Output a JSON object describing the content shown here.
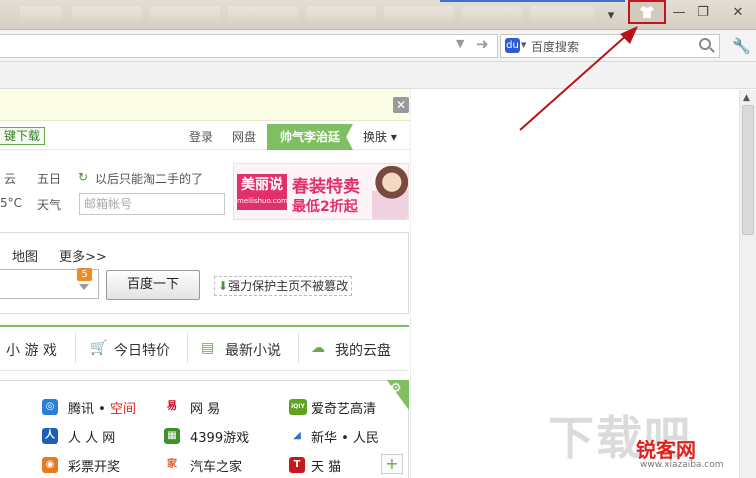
{
  "window": {
    "title_tabs": [
      "",
      "",
      "",
      "",
      "",
      "",
      "",
      ""
    ],
    "controls": {
      "skin": "",
      "minimize": "—",
      "maximize": "❐",
      "close": "✕"
    },
    "tab_dropdown": "▾"
  },
  "toolbar": {
    "address_value": "",
    "search_engine_label": "百度搜索",
    "settings_icon": "🔧"
  },
  "notice": {
    "close_symbol": "✕"
  },
  "header": {
    "quick_download": "键下载",
    "login": "登录",
    "netdisk": "网盘",
    "skin_badge": "帅气李治廷",
    "skin_menu": "换肤 ▾"
  },
  "weather": {
    "line1_a": "云",
    "line1_b": "五日",
    "tip": "以后只能淘二手的了",
    "line2_a": "5°C",
    "line2_b": "天气",
    "mailbox_placeholder": "邮箱帐号"
  },
  "ad": {
    "logo": "美丽说",
    "logo_url": "meilishuo.com",
    "headline": "春装特卖",
    "subline": "最低2折起"
  },
  "search": {
    "tabs": [
      "地图",
      "更多>>"
    ],
    "input_value": "",
    "badge": "5",
    "button": "百度一下",
    "protect_text": "强力保护主页不被篡改"
  },
  "features": {
    "items": [
      {
        "icon": "",
        "label": "小 游 戏"
      },
      {
        "icon": "🛒",
        "label": "今日特价"
      },
      {
        "icon": "▤",
        "label": "最新小说"
      },
      {
        "icon": "☁",
        "label": "我的云盘"
      }
    ]
  },
  "sites": {
    "col1": [
      {
        "label": "腾讯",
        "extra": "空间",
        "icon": "◎"
      },
      {
        "label": "人 人 网",
        "extra": "",
        "icon": "人"
      },
      {
        "label": "彩票开奖",
        "extra": "",
        "icon": "◉"
      }
    ],
    "col2": [
      {
        "label": "网  易",
        "icon": "易"
      },
      {
        "label": "4399游戏",
        "icon": "▦"
      },
      {
        "label": "汽车之家",
        "icon": "家"
      }
    ],
    "col3": [
      {
        "label": "爱奇艺高清",
        "icon": "iQIY"
      },
      {
        "label": "新华 • 人民",
        "icon": "◢"
      },
      {
        "label": "天  猫",
        "icon": "T"
      }
    ],
    "add_symbol": "+",
    "settings_symbol": "⚙"
  },
  "watermark": {
    "back_text": "下载吧",
    "main_text": "锐客网",
    "url": "www.xiazaiba.com"
  },
  "colors": {
    "accent_green": "#7fbf62",
    "highlight_red": "#c0151b",
    "brand_pink": "#e2306e"
  }
}
